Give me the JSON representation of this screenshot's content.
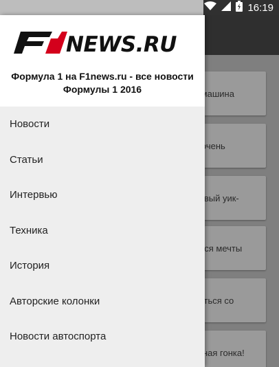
{
  "status_bar": {
    "time": "16:19",
    "icons": [
      "wifi-icon",
      "cellular-signal-icon",
      "battery-charging-icon"
    ]
  },
  "drawer": {
    "logo_text": "F1NEWS.RU",
    "header_title": "Формула 1 на F1news.ru - все новости Формулы 1 2016",
    "menu": [
      {
        "label": "Новости"
      },
      {
        "label": "Статьи"
      },
      {
        "label": "Интервью"
      },
      {
        "label": "Техника"
      },
      {
        "label": "История"
      },
      {
        "label": "Авторские колонки"
      },
      {
        "label": "Новости автоспорта"
      }
    ]
  },
  "background_cards": [
    {
      "text": "я машина"
    },
    {
      "text": "и очень"
    },
    {
      "text": "ливый уик-"
    },
    {
      "text": "ются мечты"
    },
    {
      "text": "риться со"
    },
    {
      "text": "ятная гонка!"
    }
  ]
}
